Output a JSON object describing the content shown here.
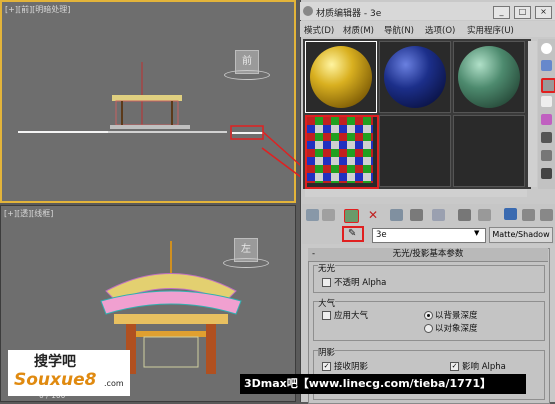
{
  "viewport_top": {
    "label": "[+][前][明暗处理]"
  },
  "viewport_bottom": {
    "label": "[+][透][线框]",
    "cube_label": "左"
  },
  "viewport_top_cube": "前",
  "bottom_status": "0 / 100",
  "material_editor": {
    "title": "材质编辑器 - 3e",
    "window_buttons": [
      "_",
      "□",
      "×"
    ],
    "menu": [
      "模式(D)",
      "材质(M)",
      "导航(N)",
      "选项(O)",
      "实用程序(U)"
    ],
    "material_name": "3e",
    "material_type": "Matte/Shadow",
    "rollout": {
      "title": "无光/投影基本参数",
      "group_matte": "无光",
      "opaque_alpha": "不透明 Alpha",
      "group_atmosphere": "大气",
      "apply_atmosphere": "应用大气",
      "at_background_depth": "以背景深度",
      "at_object_depth": "以对象深度",
      "group_shadow": "阴影",
      "receive_shadows": "接收阴影",
      "affect_alpha": "影响 Alpha"
    }
  },
  "watermark": {
    "text": "3Dmax吧【www.linecg.com/tieba/1771】"
  },
  "logo": {
    "top": "搜学吧",
    "bottom": "Souxue8",
    "suffix": ".com"
  },
  "colors": {
    "sphere1": "#d9b020",
    "sphere2": "#1c2f8a",
    "sphere3": "#4d8a6e",
    "highlight": "#e02020",
    "selection": "#e3b43a"
  }
}
